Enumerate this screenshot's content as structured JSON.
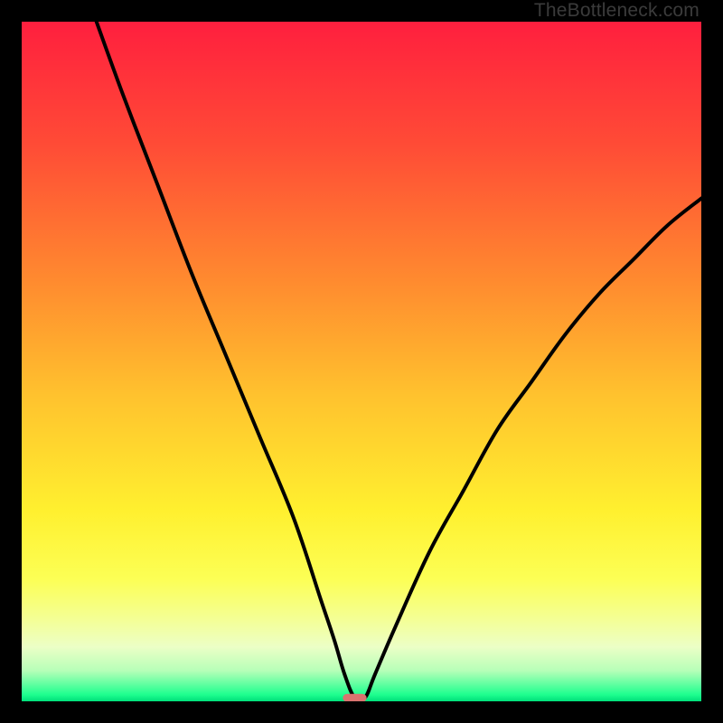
{
  "watermark": "TheBottleneck.com",
  "chart_data": {
    "type": "line",
    "title": "",
    "xlabel": "",
    "ylabel": "",
    "xlim": [
      0,
      100
    ],
    "ylim": [
      0,
      100
    ],
    "grid": false,
    "legend": false,
    "description": "Bottleneck curve approaching zero near x≈49, steeper on the left side than the right. Background is a vertical gradient from red (top) through orange/yellow to green (bottom) over a black frame.",
    "series": [
      {
        "name": "bottleneck-curve",
        "x": [
          11,
          15,
          20,
          25,
          30,
          35,
          40,
          44,
          46,
          47.5,
          49,
          50.5,
          52,
          55,
          60,
          65,
          70,
          75,
          80,
          85,
          90,
          95,
          100
        ],
        "y": [
          100,
          89,
          76,
          63,
          51,
          39,
          27,
          15,
          9,
          4,
          0.5,
          0.5,
          4,
          11,
          22,
          31,
          40,
          47,
          54,
          60,
          65,
          70,
          74
        ]
      }
    ],
    "marker": {
      "x": 49,
      "y": 0.5,
      "width": 3.5,
      "height": 1.2,
      "color": "#d9736f"
    },
    "gradient_stops": [
      {
        "offset": 0.0,
        "color": "#ff1f3e"
      },
      {
        "offset": 0.18,
        "color": "#ff4b36"
      },
      {
        "offset": 0.38,
        "color": "#ff8a2f"
      },
      {
        "offset": 0.55,
        "color": "#ffc22e"
      },
      {
        "offset": 0.72,
        "color": "#fff02f"
      },
      {
        "offset": 0.82,
        "color": "#fcff55"
      },
      {
        "offset": 0.88,
        "color": "#f4ff96"
      },
      {
        "offset": 0.92,
        "color": "#ecffc6"
      },
      {
        "offset": 0.955,
        "color": "#b6ffb8"
      },
      {
        "offset": 0.99,
        "color": "#1fff8f"
      },
      {
        "offset": 1.0,
        "color": "#00e07a"
      }
    ]
  }
}
